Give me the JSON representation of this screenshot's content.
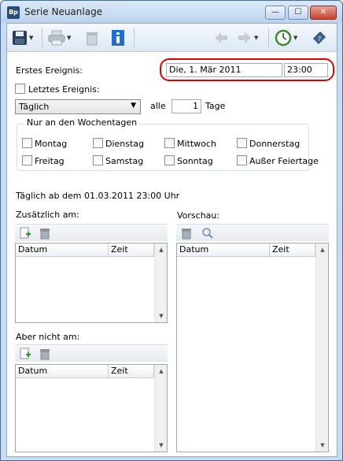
{
  "window": {
    "title": "Serie Neuanlage",
    "app_icon_text": "Bp"
  },
  "caption_buttons": {
    "minimize": "—",
    "maximize": "☐",
    "close": "✕"
  },
  "first_event": {
    "label": "Erstes Ereignis:",
    "date": "Die, 1. Mär 2011",
    "time": "23:00"
  },
  "last_event": {
    "label": "Letztes Ereignis:",
    "checked": false
  },
  "recurrence": {
    "selected": "Täglich",
    "every_label": "alle",
    "every_value": "1",
    "unit": "Tage"
  },
  "weekdays": {
    "title": "Nur an den Wochentagen",
    "items": [
      {
        "label": "Montag",
        "checked": false
      },
      {
        "label": "Dienstag",
        "checked": false
      },
      {
        "label": "Mittwoch",
        "checked": false
      },
      {
        "label": "Donnerstag",
        "checked": false
      },
      {
        "label": "Freitag",
        "checked": false
      },
      {
        "label": "Samstag",
        "checked": false
      },
      {
        "label": "Sonntag",
        "checked": false
      },
      {
        "label": "Außer Feiertage",
        "checked": false
      }
    ]
  },
  "summary": "Täglich ab dem 01.03.2011 23:00 Uhr",
  "additional": {
    "title": "Zusätzlich am:",
    "columns": [
      "Datum",
      "Zeit"
    ],
    "rows": []
  },
  "except": {
    "title": "Aber nicht am:",
    "columns": [
      "Datum",
      "Zeit"
    ],
    "rows": []
  },
  "preview": {
    "title": "Vorschau:",
    "columns": [
      "Datum",
      "Zeit"
    ],
    "rows": []
  },
  "icons": {
    "save": "floppy-disk-icon",
    "print": "printer-icon",
    "delete": "trash-icon",
    "info": "info-icon",
    "back": "arrow-left-icon",
    "forward": "arrow-right-icon",
    "clock": "clock-icon",
    "help": "help-book-icon",
    "add": "add-document-icon",
    "search": "magnifier-icon"
  },
  "colors": {
    "highlight": "#e00000",
    "title_bar": "#c9dcf0",
    "info_blue": "#1e6fd0"
  }
}
